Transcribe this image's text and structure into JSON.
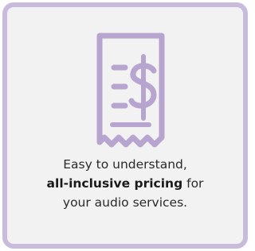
{
  "card": {
    "icon": "receipt-dollar-icon",
    "accent_color": "#b7a4cf",
    "border_color": "#c9bbdc",
    "background_color": "#f2f2f2",
    "line1": "Easy to understand,",
    "line2_bold": "all-inclusive pricing",
    "line2_rest": " for",
    "line3": "your audio services."
  }
}
